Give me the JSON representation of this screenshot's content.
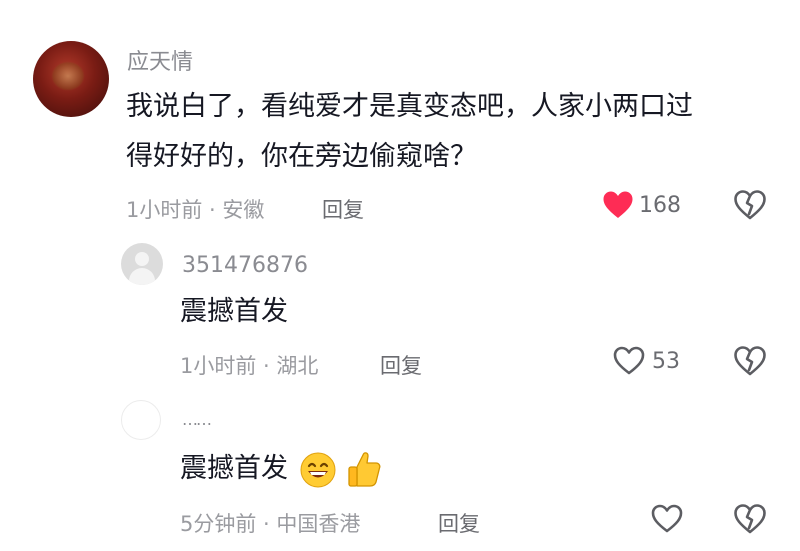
{
  "comments": [
    {
      "username": "应天情",
      "text_lines": [
        "我说白了，看纯爱才是真变态吧，人家小两口过",
        "得好好的，你在旁边偷窥啥？"
      ],
      "time_location": "1小时前 · 安徽",
      "reply_label": "回复",
      "like_count": "168",
      "liked": true
    },
    {
      "username": "351476876",
      "text": "震撼首发",
      "time_location": "1小时前 · 湖北",
      "reply_label": "回复",
      "like_count": "53",
      "liked": false
    },
    {
      "username": "……",
      "text": "震撼首发",
      "emojis": [
        "grinning-face",
        "thumbs-up"
      ],
      "time_location": "5分钟前 · 中国香港",
      "reply_label": "回复",
      "like_count": "",
      "liked": false
    }
  ],
  "colors": {
    "like_active": "#fe2c55",
    "icon_gray": "#5c5d62"
  },
  "icons": [
    "heart-filled-icon",
    "heart-outline-icon",
    "broken-heart-icon",
    "default-avatar-icon"
  ]
}
